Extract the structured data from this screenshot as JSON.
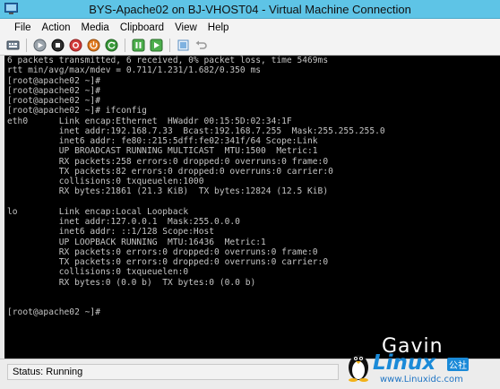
{
  "window": {
    "title": "BYS-Apache02 on BJ-VHOST04 - Virtual Machine Connection"
  },
  "menu": {
    "items": [
      "File",
      "Action",
      "Media",
      "Clipboard",
      "View",
      "Help"
    ]
  },
  "toolbar": {
    "buttons": [
      "ctrl-alt-del-icon",
      "start-icon",
      "turn-off-icon",
      "shut-down-icon",
      "power-icon",
      "reset-icon",
      "pause-icon",
      "resume-icon",
      "checkpoint-icon",
      "revert-icon"
    ]
  },
  "console": {
    "lines": [
      "6 packets transmitted, 6 received, 0% packet loss, time 5469ms",
      "rtt min/avg/max/mdev = 0.711/1.231/1.682/0.350 ms",
      "[root@apache02 ~]#",
      "[root@apache02 ~]#",
      "[root@apache02 ~]#",
      "[root@apache02 ~]# ifconfig",
      "eth0      Link encap:Ethernet  HWaddr 00:15:5D:02:34:1F",
      "          inet addr:192.168.7.33  Bcast:192.168.7.255  Mask:255.255.255.0",
      "          inet6 addr: fe80::215:5dff:fe02:341f/64 Scope:Link",
      "          UP BROADCAST RUNNING MULTICAST  MTU:1500  Metric:1",
      "          RX packets:258 errors:0 dropped:0 overruns:0 frame:0",
      "          TX packets:82 errors:0 dropped:0 overruns:0 carrier:0",
      "          collisions:0 txqueuelen:1000",
      "          RX bytes:21861 (21.3 KiB)  TX bytes:12824 (12.5 KiB)",
      "",
      "lo        Link encap:Local Loopback",
      "          inet addr:127.0.0.1  Mask:255.0.0.0",
      "          inet6 addr: ::1/128 Scope:Host",
      "          UP LOOPBACK RUNNING  MTU:16436  Metric:1",
      "          RX packets:0 errors:0 dropped:0 overruns:0 frame:0",
      "          TX packets:0 errors:0 dropped:0 overruns:0 carrier:0",
      "          collisions:0 txqueuelen:0",
      "          RX bytes:0 (0.0 b)  TX bytes:0 (0.0 b)",
      "",
      "",
      "[root@apache02 ~]#"
    ]
  },
  "status": {
    "text": "Status: Running"
  },
  "watermark": {
    "name": "Gavin",
    "brand": "Linux",
    "brand_suffix": "公社",
    "url": "www.Linuxidc.com"
  },
  "colors": {
    "titlebar": "#5ec4e6",
    "console_bg": "#000000",
    "console_fg": "#c4c4c4",
    "brand_blue": "#1a8ad8"
  }
}
